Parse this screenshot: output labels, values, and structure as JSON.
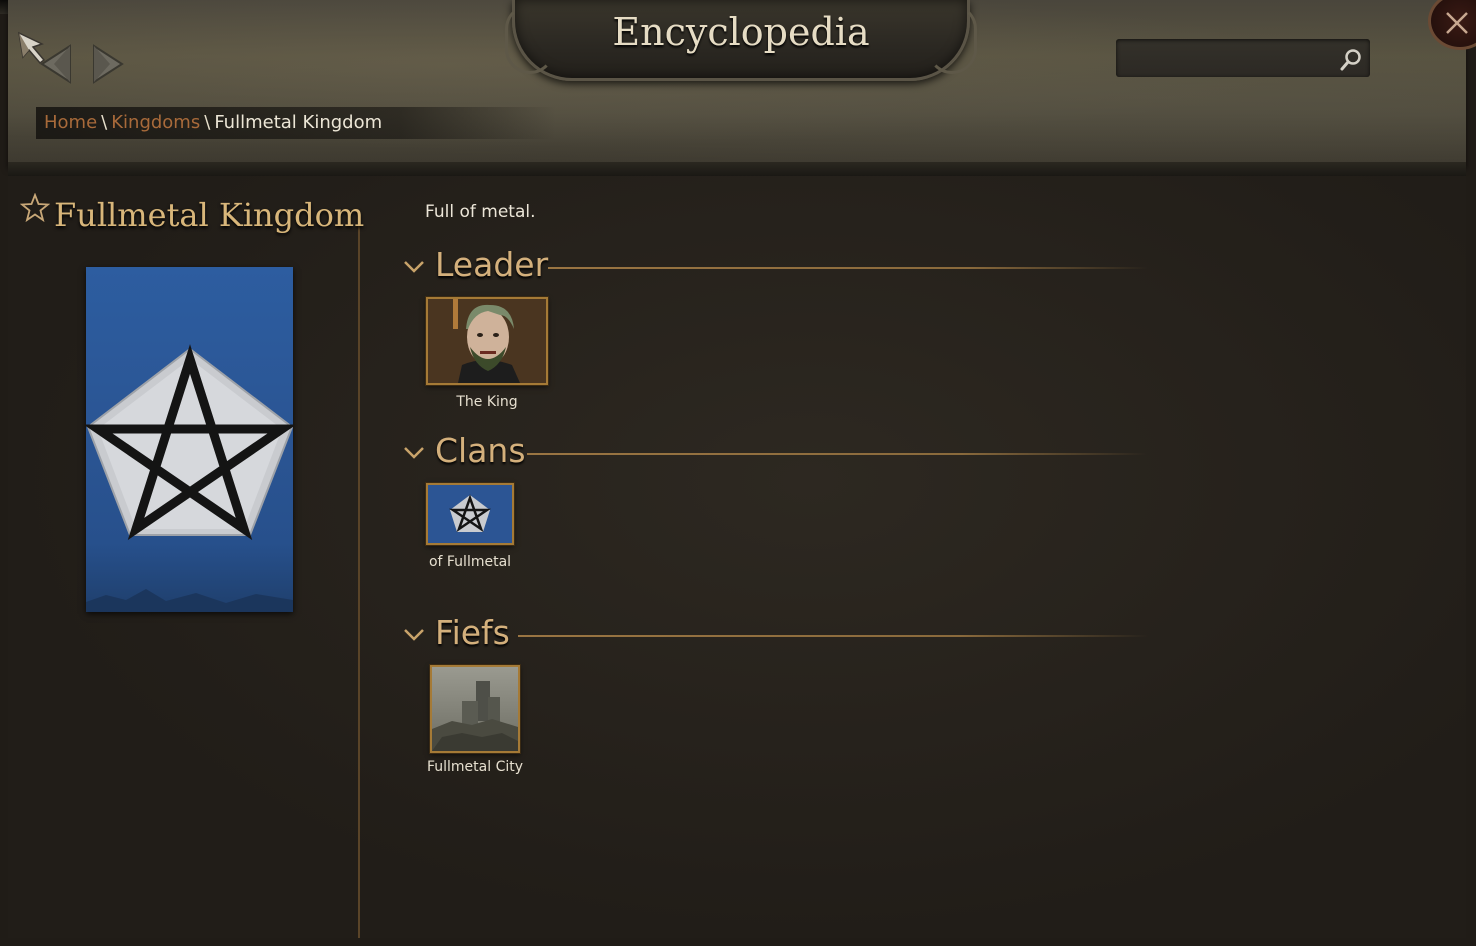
{
  "window": {
    "title": "Encyclopedia"
  },
  "search": {
    "value": "",
    "placeholder": ""
  },
  "breadcrumb": {
    "home": "Home",
    "separator": "\\",
    "kingdoms": "Kingdoms",
    "current": "Fullmetal Kingdom"
  },
  "kingdom": {
    "name": "Fullmetal Kingdom",
    "description": "Full of metal.",
    "banner_color": "#2d5da0",
    "banner_sigil": "pentagram-on-silver-pentagon"
  },
  "sections": {
    "leader": {
      "title": "Leader",
      "items": [
        {
          "label": "The King",
          "icon": "portrait-icon"
        }
      ]
    },
    "clans": {
      "title": "Clans",
      "items": [
        {
          "label": "of Fullmetal",
          "icon": "clan-banner-icon"
        }
      ]
    },
    "fiefs": {
      "title": "Fiefs",
      "items": [
        {
          "label": "Fullmetal City",
          "icon": "castle-icon"
        }
      ]
    }
  },
  "icons": {
    "back": "arrow-left-icon",
    "forward": "arrow-right-icon",
    "search": "search-icon",
    "close": "close-icon",
    "favorite": "star-icon",
    "collapse": "chevron-down-icon"
  },
  "colors": {
    "accent_gold": "#d4b07c",
    "link": "#a86a3a",
    "divider": "#5a4428"
  }
}
